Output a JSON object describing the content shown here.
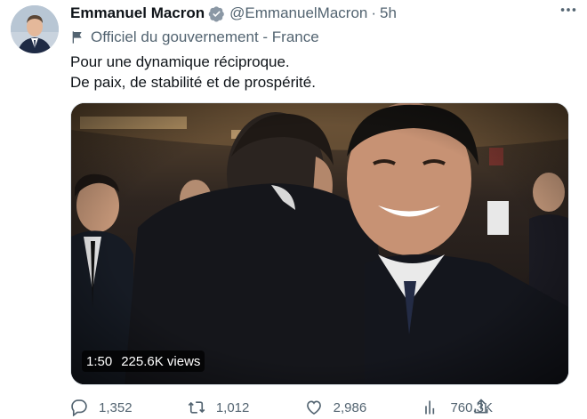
{
  "author": {
    "name": "Emmanuel Macron",
    "handle": "@EmmanuelMacron",
    "separator": "·",
    "time": "5h",
    "verified": true,
    "verified_color": "#8b98a5"
  },
  "label": {
    "icon": "flag-icon",
    "text": "Officiel du gouvernement - France"
  },
  "tweet": {
    "line1": "Pour une dynamique réciproque.",
    "line2": "De paix, de stabilité et de prospérité."
  },
  "video": {
    "duration": "1:50",
    "views": "225.6K views"
  },
  "actions": {
    "replies": "1,352",
    "retweets": "1,012",
    "likes": "2,986",
    "views": "760.3K"
  },
  "colors": {
    "text": "#0f1419",
    "secondary": "#536471"
  }
}
